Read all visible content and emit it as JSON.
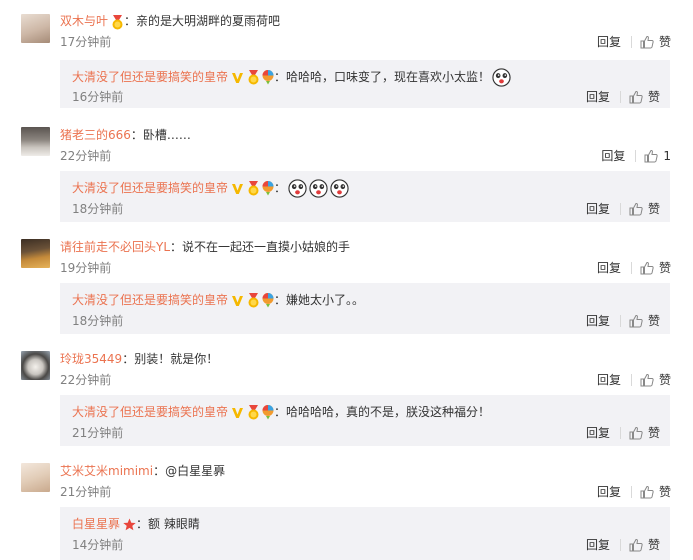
{
  "ui": {
    "reply_label": "回复",
    "like_label": "赞"
  },
  "colors": {
    "username": "#eb7350",
    "reply_bg": "#f2f2f5",
    "time": "#808080"
  },
  "comments": [
    {
      "username": "双木与叶",
      "text": "：亲的是大明湖畔的夏雨荷吧",
      "time": "17分钟前",
      "like": "赞",
      "reply": {
        "username": "大清没了但还是要搞笑的皇帝",
        "text": "：哈哈哈，口味变了，现在喜欢小太监！",
        "time": "16分钟前",
        "like": "赞"
      }
    },
    {
      "username": "猪老三的666",
      "text": "：卧槽……",
      "time": "22分钟前",
      "like": "1",
      "reply": {
        "username": "大清没了但还是要搞笑的皇帝",
        "text": "：",
        "time": "18分钟前",
        "like": "赞"
      }
    },
    {
      "username": "请往前走不必回头YL",
      "text": "：说不在一起还一直摸小姑娘的手",
      "time": "19分钟前",
      "like": "赞",
      "reply": {
        "username": "大清没了但还是要搞笑的皇帝",
        "text": "：嫌她太小了。。",
        "time": "18分钟前",
        "like": "赞"
      }
    },
    {
      "username": "玲珑35449",
      "text": "：别装！就是你！",
      "time": "22分钟前",
      "like": "赞",
      "reply": {
        "username": "大清没了但还是要搞笑的皇帝",
        "text": "：哈哈哈哈，真的不是，朕没这种福分！",
        "time": "21分钟前",
        "like": "赞"
      }
    },
    {
      "username": "艾米艾米mimimi",
      "text": "：@白星星奡",
      "time": "21分钟前",
      "like": "赞",
      "reply": {
        "username": "白星星奡",
        "text": "：额 辣眼睛",
        "time": "14分钟前",
        "like": "赞"
      }
    }
  ]
}
